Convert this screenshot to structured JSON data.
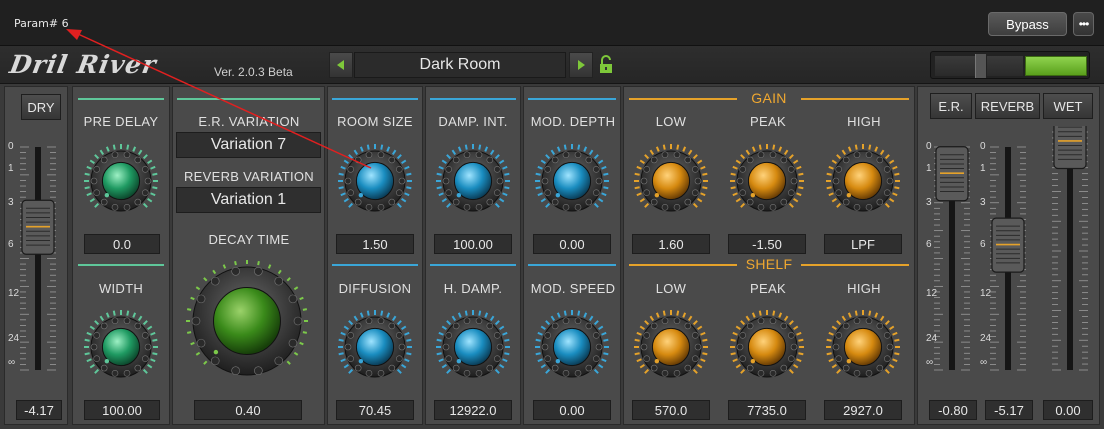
{
  "topbar": {
    "param_label": "Param# 6",
    "bypass_label": "Bypass",
    "more_label": "•••"
  },
  "header": {
    "logo": "Dril River",
    "version": "Ver. 2.0.3 Beta",
    "preset": "Dark Room",
    "prev_icon": "triangle-left-icon",
    "next_icon": "triangle-right-icon",
    "lock_icon": "unlock-icon"
  },
  "dry": {
    "button": "DRY",
    "value": "-4.17",
    "level": 0.35
  },
  "predelay": {
    "label": "PRE DELAY",
    "value": "0.0"
  },
  "width": {
    "label": "WIDTH",
    "value": "100.00"
  },
  "er_variation": {
    "label": "E.R. VARIATION",
    "value": "Variation 7"
  },
  "reverb_variation": {
    "label": "REVERB VARIATION",
    "value": "Variation 1"
  },
  "decay": {
    "label": "DECAY TIME",
    "value": "0.40"
  },
  "room_size": {
    "label": "ROOM SIZE",
    "value": "1.50"
  },
  "diffusion": {
    "label": "DIFFUSION",
    "value": "70.45"
  },
  "damp_int": {
    "label": "DAMP. INT.",
    "value": "100.00"
  },
  "h_damp": {
    "label": "H. DAMP.",
    "value": "12922.0"
  },
  "mod_depth": {
    "label": "MOD. DEPTH",
    "value": "0.00"
  },
  "mod_speed": {
    "label": "MOD. SPEED",
    "value": "0.00"
  },
  "gain": {
    "title": "GAIN",
    "low_label": "LOW",
    "peak_label": "PEAK",
    "high_label": "HIGH",
    "low_value": "1.60",
    "peak_value": "-1.50",
    "high_value": "LPF"
  },
  "shelf": {
    "title": "SHELF",
    "low_label": "LOW",
    "peak_label": "PEAK",
    "high_label": "HIGH",
    "low_value": "570.0",
    "peak_value": "7735.0",
    "high_value": "2927.0"
  },
  "output": {
    "er_button": "E.R.",
    "reverb_button": "REVERB",
    "wet_button": "WET",
    "er_value": "-0.80",
    "reverb_value": "-5.17",
    "wet_value": "0.00"
  },
  "scale": [
    "0",
    "1",
    "3",
    "6",
    "12",
    "24",
    "∞"
  ],
  "colors": {
    "green": "#5fc79a",
    "blue": "#3aa6d8",
    "orange": "#e5a22a",
    "annotation": "#e02020"
  }
}
